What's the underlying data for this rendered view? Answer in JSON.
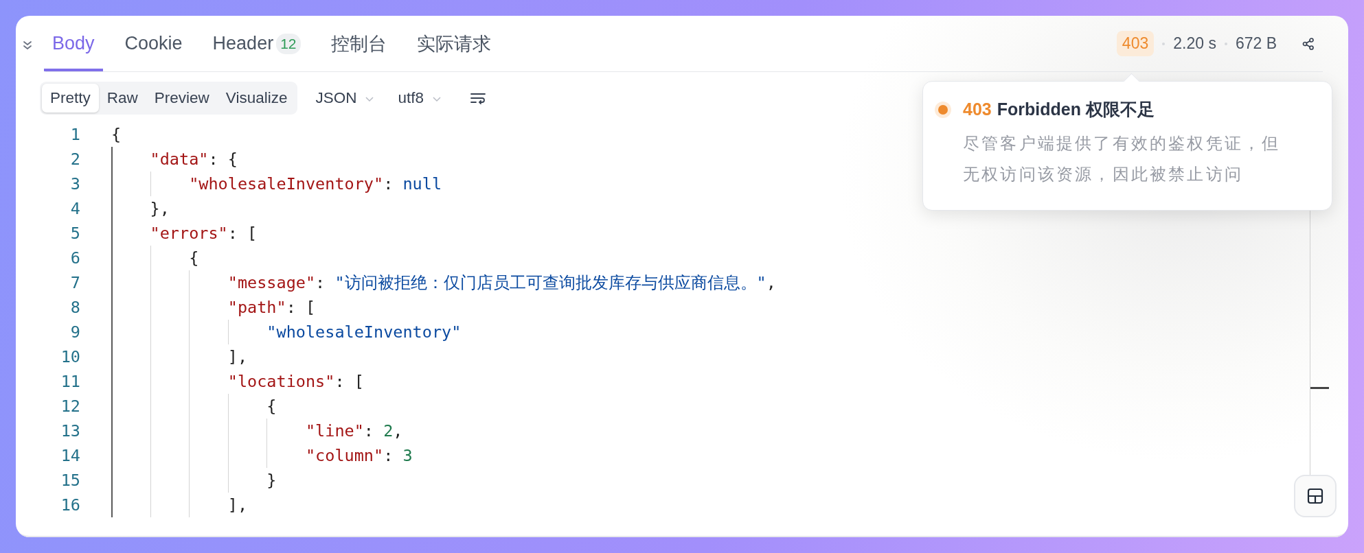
{
  "tabs": [
    {
      "label": "Body",
      "selected": true
    },
    {
      "label": "Cookie",
      "selected": false
    },
    {
      "label": "Header",
      "badge": "12",
      "selected": false
    },
    {
      "label": "控制台",
      "selected": false
    },
    {
      "label": "实际请求",
      "selected": false
    }
  ],
  "response": {
    "status": "403",
    "time": "2.20 s",
    "size": "672 B"
  },
  "view_modes": [
    {
      "label": "Pretty",
      "selected": true
    },
    {
      "label": "Raw",
      "selected": false
    },
    {
      "label": "Preview",
      "selected": false
    },
    {
      "label": "Visualize",
      "selected": false
    }
  ],
  "format_dropdown": {
    "value": "JSON"
  },
  "encoding_dropdown": {
    "value": "utf8"
  },
  "code_lines": [
    {
      "number": "1",
      "tokens": [
        {
          "kind": "punct",
          "text": "{"
        }
      ]
    },
    {
      "number": "2",
      "tokens": [
        {
          "kind": "key",
          "text": "    \"data\""
        },
        {
          "kind": "punct",
          "text": ": {"
        }
      ]
    },
    {
      "number": "3",
      "tokens": [
        {
          "kind": "key",
          "text": "        \"wholesaleInventory\""
        },
        {
          "kind": "punct",
          "text": ": "
        },
        {
          "kind": "null",
          "text": "null"
        }
      ]
    },
    {
      "number": "4",
      "tokens": [
        {
          "kind": "punct",
          "text": "    },"
        }
      ]
    },
    {
      "number": "5",
      "tokens": [
        {
          "kind": "key",
          "text": "    \"errors\""
        },
        {
          "kind": "punct",
          "text": ": ["
        }
      ]
    },
    {
      "number": "6",
      "tokens": [
        {
          "kind": "punct",
          "text": "        {"
        }
      ]
    },
    {
      "number": "7",
      "tokens": [
        {
          "kind": "key",
          "text": "            \"message\""
        },
        {
          "kind": "punct",
          "text": ": "
        },
        {
          "kind": "string",
          "text": "\"访问被拒绝：仅门店员工可查询批发库存与供应商信息。\""
        },
        {
          "kind": "punct",
          "text": ","
        }
      ]
    },
    {
      "number": "8",
      "tokens": [
        {
          "kind": "key",
          "text": "            \"path\""
        },
        {
          "kind": "punct",
          "text": ": ["
        }
      ]
    },
    {
      "number": "9",
      "tokens": [
        {
          "kind": "string",
          "text": "                \"wholesaleInventory\""
        }
      ]
    },
    {
      "number": "10",
      "tokens": [
        {
          "kind": "punct",
          "text": "            ],"
        }
      ]
    },
    {
      "number": "11",
      "tokens": [
        {
          "kind": "key",
          "text": "            \"locations\""
        },
        {
          "kind": "punct",
          "text": ": ["
        }
      ]
    },
    {
      "number": "12",
      "tokens": [
        {
          "kind": "punct",
          "text": "                {"
        }
      ]
    },
    {
      "number": "13",
      "tokens": [
        {
          "kind": "key",
          "text": "                    \"line\""
        },
        {
          "kind": "punct",
          "text": ": "
        },
        {
          "kind": "number",
          "text": "2"
        },
        {
          "kind": "punct",
          "text": ","
        }
      ]
    },
    {
      "number": "14",
      "tokens": [
        {
          "kind": "key",
          "text": "                    \"column\""
        },
        {
          "kind": "punct",
          "text": ": "
        },
        {
          "kind": "number",
          "text": "3"
        }
      ]
    },
    {
      "number": "15",
      "tokens": [
        {
          "kind": "punct",
          "text": "                }"
        }
      ]
    },
    {
      "number": "16",
      "tokens": [
        {
          "kind": "punct",
          "text": "            ],"
        }
      ]
    }
  ],
  "popover": {
    "code": "403",
    "title": "Forbidden 权限不足",
    "description": "尽管客户端提供了有效的鉴权凭证，但无权访问该资源，因此被禁止访问"
  }
}
